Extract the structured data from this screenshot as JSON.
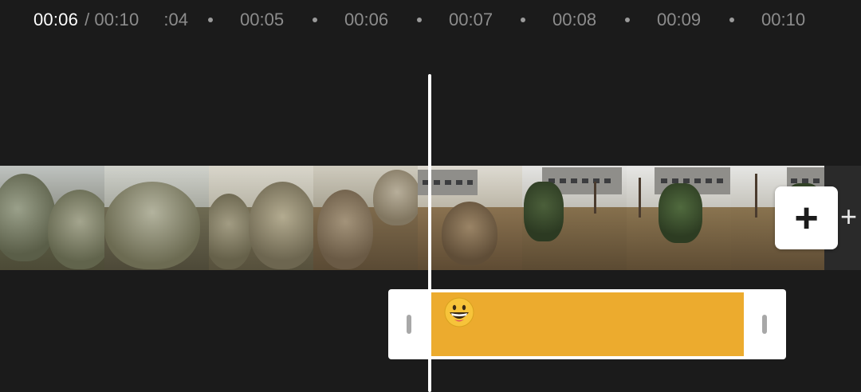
{
  "time_readout": {
    "current": "00:06",
    "separator": "/",
    "total": "00:10"
  },
  "ruler": {
    "cut_label": "00:04",
    "ticks": [
      "00:05",
      "00:06",
      "00:07",
      "00:08",
      "00:09",
      "00:10"
    ]
  },
  "track": {
    "add_clip_icon": "plus-icon",
    "add_end_icon": "plus-icon",
    "add_clip_symbol": "+",
    "add_end_symbol": "+"
  },
  "sticker": {
    "emoji": "grinning-face",
    "fill_color": "#ecab2e"
  },
  "colors": {
    "background": "#1b1b1b",
    "playhead": "#ffffff",
    "text_active": "#ffffff",
    "text_muted": "#8c8c8c"
  }
}
